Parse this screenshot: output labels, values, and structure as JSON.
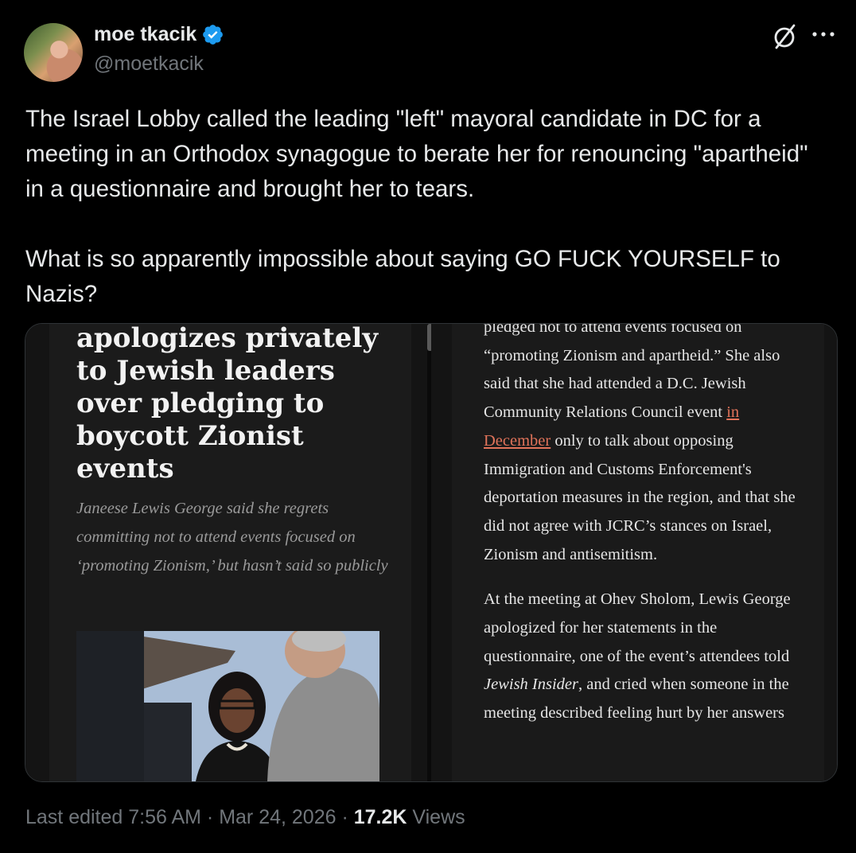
{
  "author": {
    "name": "moe tkacik",
    "handle": "@moetkacik",
    "verified": true
  },
  "tweet": {
    "text": "The Israel Lobby called the leading \"left\" mayoral candidate in DC for a meeting in an Orthodox synagogue to berate her for renouncing \"apartheid\" in a questionnaire and brought her to tears.\n\nWhat is so apparently impossible about saying GO FUCK YOURSELF to Nazis?"
  },
  "media": {
    "left": {
      "headline": "apologizes privately to Jewish leaders over pledging to boycott Zionist events",
      "dek": "Janeese Lewis George said she regrets committing not to attend events focused on ‘promoting Zionism,’ but hasn’t said so publicly"
    },
    "right": {
      "p1_clipped": "pledged not to attend events focused on",
      "p1_a": "“promoting Zionism and apartheid.” She also said that she had attended a D.C. Jewish Community Relations Council event ",
      "p1_link": "in December",
      "p1_b": " only to talk about opposing Immigration and Customs Enforcement's deportation measures in the region, and that she did not agree with JCRC’s stances on Israel, Zionism and antisemitism.",
      "p2_a": "At the meeting at Ohev Sholom, Lewis George apologized for her statements in the questionnaire, one of the event’s attendees told ",
      "p2_italic": "Jewish Insider",
      "p2_b": ", and cried when someone in the meeting described feeling hurt by her answers"
    }
  },
  "footer": {
    "edited": "Last edited 7:56 AM · Mar 24, 2026 · ",
    "views_count": "17.2K",
    "views_label": " Views"
  },
  "colors": {
    "background": "#000000",
    "verified": "#1d9bf0",
    "muted": "#71767b",
    "link": "#e0735a"
  },
  "icons": [
    "verified-badge-icon",
    "grok-icon",
    "more-icon"
  ]
}
